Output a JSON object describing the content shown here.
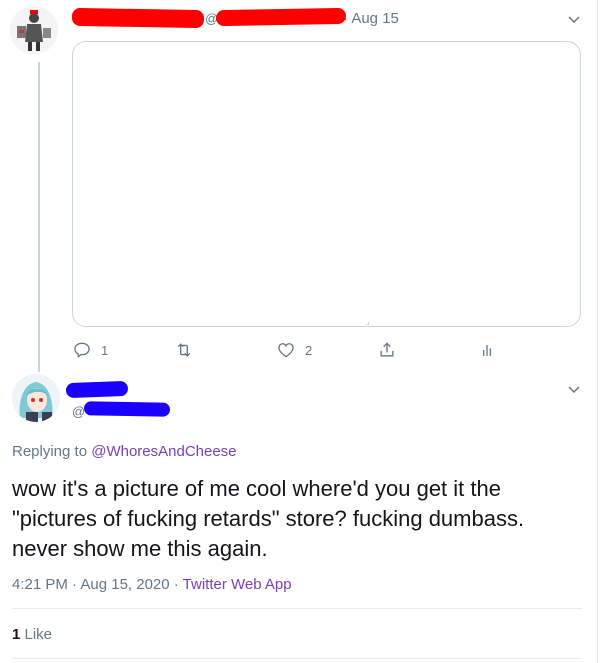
{
  "parent_tweet": {
    "handle_prefix": "@",
    "date": "· Aug 15",
    "actions": {
      "reply_count": "1",
      "retweet_count": "",
      "like_count": "2"
    }
  },
  "reply_tweet": {
    "handle_prefix": "@",
    "replying_to_prefix": "Replying to ",
    "replying_to_handle": "@WhoresAndCheese",
    "text": "wow it's a picture of me cool where'd you get it the \"pictures of fucking retards\" store? fucking dumbass. never show me this again.",
    "timestamp": "4:21 PM · Aug 15, 2020 · ",
    "source": "Twitter Web App",
    "like_count": "1",
    "like_label": " Like"
  },
  "colors": {
    "redaction_red": "#ff0000",
    "redaction_blue": "#1a00ff",
    "link_purple": "#7b3fb5",
    "muted_gray": "#657786"
  }
}
